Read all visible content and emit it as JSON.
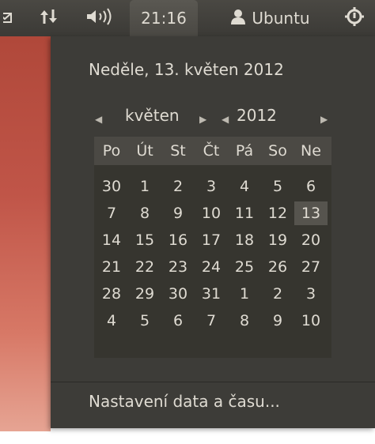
{
  "panel": {
    "clock": "21:16",
    "user_name": "Ubuntu"
  },
  "calendar_menu": {
    "date_heading": "Neděle, 13. květen 2012",
    "month_label": "květen",
    "year_label": "2012",
    "weekdays": [
      "Po",
      "Út",
      "St",
      "Čt",
      "Pá",
      "So",
      "Ne"
    ],
    "weeks": [
      [
        "30",
        "1",
        "2",
        "3",
        "4",
        "5",
        "6"
      ],
      [
        "7",
        "8",
        "9",
        "10",
        "11",
        "12",
        "13"
      ],
      [
        "14",
        "15",
        "16",
        "17",
        "18",
        "19",
        "20"
      ],
      [
        "21",
        "22",
        "23",
        "24",
        "25",
        "26",
        "27"
      ],
      [
        "28",
        "29",
        "30",
        "31",
        "1",
        "2",
        "3"
      ],
      [
        "4",
        "5",
        "6",
        "7",
        "8",
        "9",
        "10"
      ]
    ],
    "selected_day": "13",
    "settings_label": "Nastavení data a času..."
  },
  "icons": {
    "mail": "mail-icon",
    "network": "network-updown-icon",
    "sound": "speaker-volume-icon",
    "user": "user-icon",
    "session": "power-gear-icon"
  },
  "colors": {
    "panel_bg": "#3d3c38",
    "text": "#dfdbd2",
    "calendar_bg": "#36352f",
    "weekday_header_bg": "#4b4944",
    "today_bg": "#56544e",
    "wallpaper": "#c05548"
  }
}
